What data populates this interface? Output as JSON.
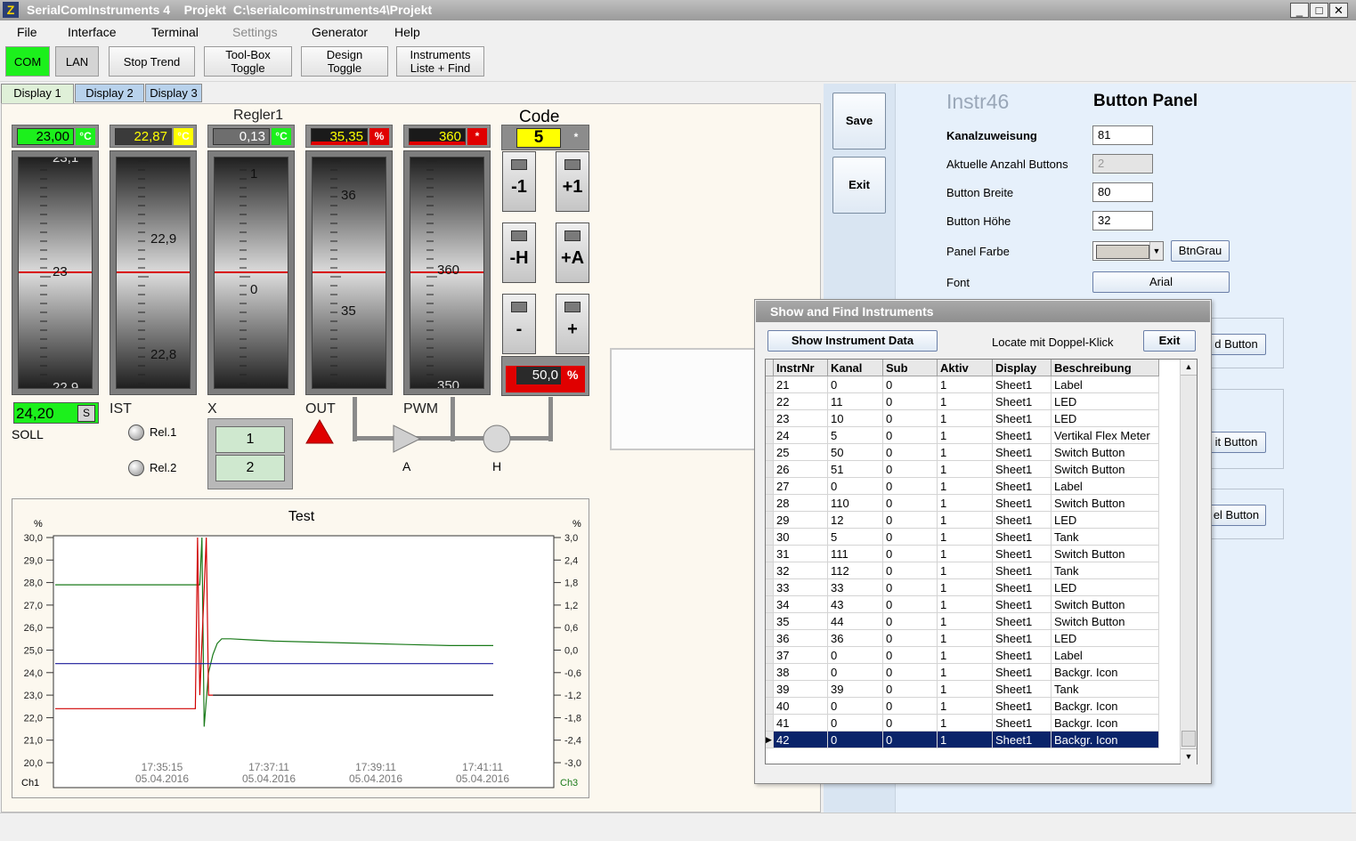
{
  "window": {
    "title": "SerialComInstruments 4    Projekt  C:\\serialcominstruments4\\Projekt",
    "icon": "app-logo-icon",
    "min": "_",
    "max": "□",
    "close": "✕"
  },
  "menu": [
    "File",
    "Interface",
    "Terminal",
    "Settings",
    "Generator",
    "Help"
  ],
  "toolbar": {
    "com": "COM",
    "lan": "LAN",
    "stop_trend": "Stop Trend",
    "toolbox_1": "Tool-Box",
    "toolbox_2": "Toggle",
    "design_1": "Design",
    "design_2": "Toggle",
    "instr_1": "Instruments",
    "instr_2": "Liste + Find"
  },
  "tabs": [
    "Display 1",
    "Display 2",
    "Display 3"
  ],
  "instruments": {
    "soll": {
      "value": "23,00",
      "unit": "°C",
      "setpoint": "24,20",
      "s_btn": "S",
      "label": "SOLL",
      "scale": [
        "23,1",
        "23",
        "22,9"
      ]
    },
    "ist": {
      "value": "22,87",
      "unit": "°C",
      "label": "IST",
      "scale": [
        "22,9",
        "22,8"
      ]
    },
    "regler": {
      "title": "Regler1",
      "value": "0,13",
      "unit": "°C",
      "label": "X",
      "scale": [
        "1",
        "0"
      ]
    },
    "out": {
      "value": "35,35",
      "unit": "%",
      "label": "OUT",
      "scale": [
        "36",
        "35"
      ]
    },
    "pwm": {
      "value": "360",
      "unit": "*",
      "label": "PWM",
      "scale": [
        "360",
        "350"
      ]
    },
    "code": {
      "title": "Code",
      "value": "5",
      "unit": "*",
      "buttons": [
        "-1",
        "+1",
        "-H",
        "+A",
        "-",
        "+"
      ],
      "pct_value": "50,0",
      "pct_unit": "%"
    },
    "relays": [
      "Rel.1",
      "Rel.2"
    ],
    "switch": [
      "1",
      "2"
    ],
    "pipe_labels": [
      "A",
      "H"
    ]
  },
  "chart_data": {
    "type": "line",
    "title": "Test",
    "ylabel_left": "%",
    "ylabel_right": "%",
    "y_left_ticks": [
      "30,0",
      "29,0",
      "28,0",
      "27,0",
      "26,0",
      "25,0",
      "24,0",
      "23,0",
      "22,0",
      "21,0",
      "20,0"
    ],
    "y_right_ticks": [
      "3,0",
      "2,4",
      "1,8",
      "1,2",
      "0,6",
      "0,0",
      "-0,6",
      "-1,2",
      "-1,8",
      "-2,4",
      "-3,0"
    ],
    "x_ticks": [
      {
        "time": "17:35:15",
        "date": "05.04.2016"
      },
      {
        "time": "17:37:11",
        "date": "05.04.2016"
      },
      {
        "time": "17:39:11",
        "date": "05.04.2016"
      },
      {
        "time": "17:41:11",
        "date": "05.04.2016"
      }
    ],
    "ylim_left": [
      20,
      30
    ],
    "ylim_right": [
      -3,
      3
    ],
    "legend_left": "Ch1",
    "legend_right": "Ch3",
    "series": [
      {
        "color": "#1a7a1a",
        "x": [
          0,
          0.33,
          0.335,
          0.34,
          0.35,
          0.36,
          0.37,
          0.38,
          0.4,
          0.45,
          0.5,
          0.6,
          0.7,
          0.8,
          0.9,
          0.95,
          1.0
        ],
        "y": [
          27.9,
          27.9,
          30.0,
          21.6,
          24.0,
          24.8,
          25.3,
          25.5,
          25.5,
          25.45,
          25.4,
          25.35,
          25.3,
          25.25,
          25.2,
          25.2,
          25.2
        ]
      },
      {
        "color": "#d00000",
        "x": [
          0,
          0.32,
          0.325,
          0.33,
          0.345,
          0.35,
          0.36
        ],
        "y": [
          22.4,
          22.4,
          30.0,
          23.0,
          30.0,
          23.0,
          23.0
        ]
      },
      {
        "color": "#1a1a9a",
        "x": [
          0,
          1.0
        ],
        "y": [
          24.4,
          24.4
        ]
      },
      {
        "color": "#000000",
        "x": [
          0.36,
          1.0
        ],
        "y": [
          23.0,
          23.0
        ]
      }
    ]
  },
  "panel": {
    "save": "Save",
    "exit": "Exit",
    "instr_name": "Instr46",
    "instr_type": "Button Panel",
    "fields": [
      {
        "label": "Kanalzuweisung",
        "value": "81",
        "bold": true
      },
      {
        "label": "Aktuelle Anzahl Buttons",
        "value": "2",
        "disabled": true
      },
      {
        "label": "Button Breite",
        "value": "80"
      },
      {
        "label": "Button Höhe",
        "value": "32"
      }
    ],
    "panel_farbe_label": "Panel Farbe",
    "panel_farbe_btn": "BtnGrau",
    "font_label": "Font",
    "font_value": "Arial",
    "group_buttons": [
      "d Button",
      "it Button",
      "el Button"
    ]
  },
  "dialog": {
    "title": "Show and Find Instruments",
    "show_btn": "Show Instrument Data",
    "locate_text": "Locate mit Doppel-Klick",
    "exit_btn": "Exit",
    "columns": [
      "InstrNr",
      "Kanal",
      "Sub",
      "Aktiv",
      "Display",
      "Beschreibung"
    ],
    "rows": [
      [
        "21",
        "0",
        "0",
        "1",
        "Sheet1",
        "Label"
      ],
      [
        "22",
        "11",
        "0",
        "1",
        "Sheet1",
        "LED"
      ],
      [
        "23",
        "10",
        "0",
        "1",
        "Sheet1",
        "LED"
      ],
      [
        "24",
        "5",
        "0",
        "1",
        "Sheet1",
        "Vertikal Flex Meter"
      ],
      [
        "25",
        "50",
        "0",
        "1",
        "Sheet1",
        "Switch Button"
      ],
      [
        "26",
        "51",
        "0",
        "1",
        "Sheet1",
        "Switch Button"
      ],
      [
        "27",
        "0",
        "0",
        "1",
        "Sheet1",
        "Label"
      ],
      [
        "28",
        "110",
        "0",
        "1",
        "Sheet1",
        "Switch Button"
      ],
      [
        "29",
        "12",
        "0",
        "1",
        "Sheet1",
        "LED"
      ],
      [
        "30",
        "5",
        "0",
        "1",
        "Sheet1",
        "Tank"
      ],
      [
        "31",
        "111",
        "0",
        "1",
        "Sheet1",
        "Switch Button"
      ],
      [
        "32",
        "112",
        "0",
        "1",
        "Sheet1",
        "Tank"
      ],
      [
        "33",
        "33",
        "0",
        "1",
        "Sheet1",
        "LED"
      ],
      [
        "34",
        "43",
        "0",
        "1",
        "Sheet1",
        "Switch Button"
      ],
      [
        "35",
        "44",
        "0",
        "1",
        "Sheet1",
        "Switch Button"
      ],
      [
        "36",
        "36",
        "0",
        "1",
        "Sheet1",
        "LED"
      ],
      [
        "37",
        "0",
        "0",
        "1",
        "Sheet1",
        "Label"
      ],
      [
        "38",
        "0",
        "0",
        "1",
        "Sheet1",
        "Backgr. Icon"
      ],
      [
        "39",
        "39",
        "0",
        "1",
        "Sheet1",
        "Tank"
      ],
      [
        "40",
        "0",
        "0",
        "1",
        "Sheet1",
        "Backgr. Icon"
      ],
      [
        "41",
        "0",
        "0",
        "1",
        "Sheet1",
        "Backgr. Icon"
      ],
      [
        "42",
        "0",
        "0",
        "1",
        "Sheet1",
        "Backgr. Icon"
      ]
    ],
    "selected_row": 21
  },
  "colors": {
    "green": "#1cf01c",
    "yellow": "#ffff00",
    "red": "#e00000",
    "selection": "#0a246a"
  }
}
